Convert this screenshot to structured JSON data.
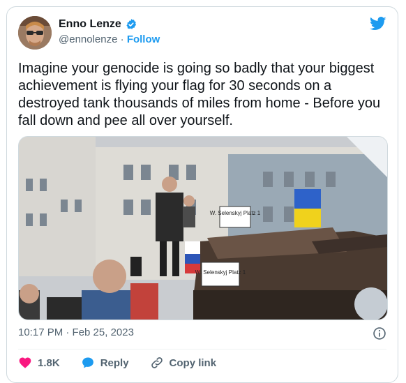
{
  "tweet": {
    "display_name": "Enno Lenze",
    "handle": "@ennolenze",
    "separator": "·",
    "follow_label": "Follow",
    "text": "Imagine your genocide is going so badly that your biggest achievement is flying your flag for 30 seconds on a destroyed tank thousands of miles from home - Before you fall down and pee all over yourself.",
    "timestamp": "10:17 PM · Feb 25, 2023",
    "likes": "1.8K",
    "reply_label": "Reply",
    "copy_link_label": "Copy link"
  },
  "photo": {
    "sign_top": "W. Selenskyj Platz 1",
    "sign_bottom": "W. Selenskyj Platz 1"
  },
  "colors": {
    "accent": "#1d9bf0",
    "like": "#f91880",
    "text": "#0f1419",
    "muted": "#536471"
  }
}
